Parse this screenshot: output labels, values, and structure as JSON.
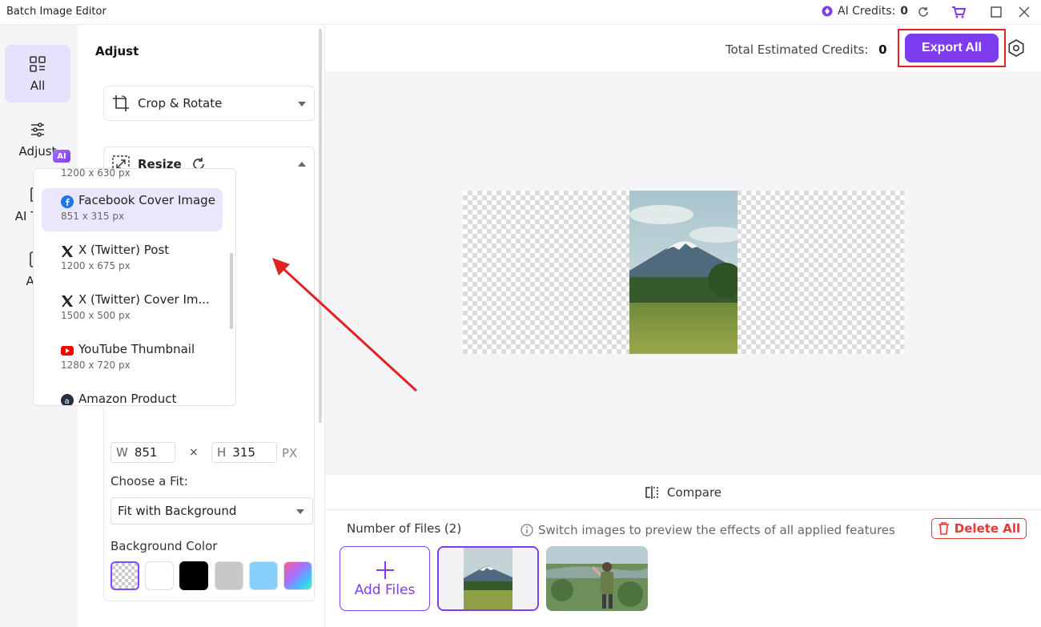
{
  "window": {
    "title": "Batch Image Editor",
    "ai_credits_label": "AI Credits:",
    "ai_credits_value": "0"
  },
  "nav": {
    "items": [
      {
        "label": "All",
        "icon": "grid-icon"
      },
      {
        "label": "Adjust",
        "icon": "sliders-icon"
      },
      {
        "label": "AI Tools",
        "icon": "ai-icon"
      },
      {
        "label": "Add",
        "icon": "plus-box-icon"
      }
    ],
    "ai_badge": "AI"
  },
  "panel": {
    "title": "Adjust",
    "crop_label": "Crop & Rotate",
    "resize_label": "Resize",
    "presets": [
      {
        "name": "",
        "size": "1200 x 630 px"
      },
      {
        "name": "Facebook Cover Image",
        "size": "851 x 315 px",
        "icon": "facebook-icon"
      },
      {
        "name": "X (Twitter) Post",
        "size": "1200 x 675 px",
        "icon": "x-icon"
      },
      {
        "name": "X (Twitter) Cover Im...",
        "size": "1500 x 500 px",
        "icon": "x-icon"
      },
      {
        "name": "YouTube Thumbnail",
        "size": "1280 x 720 px",
        "icon": "youtube-icon"
      },
      {
        "name": "Amazon Product",
        "size": "",
        "icon": "amazon-icon"
      }
    ],
    "width_label": "W",
    "width_value": "851",
    "height_label": "H",
    "height_value": "315",
    "times": "×",
    "unit": "PX",
    "fit_label": "Choose a Fit:",
    "fit_value": "Fit with Background",
    "bg_label": "Background Color",
    "swatch_colors": [
      "transparent",
      "#ffffff",
      "#000000",
      "#c8c8c8",
      "#85d0fb",
      "gradient"
    ]
  },
  "header": {
    "credits_label": "Total Estimated Credits:",
    "credits_value": "0",
    "export_label": "Export All"
  },
  "footer": {
    "compare_label": "Compare",
    "files_count": "Number of Files (2)",
    "hint": "Switch images to preview the effects of all applied features",
    "delete_label": "Delete All",
    "add_files_label": "Add Files"
  },
  "colors": {
    "accent": "#7d3cf0",
    "danger": "#e53935",
    "annotation": "#e32222"
  }
}
